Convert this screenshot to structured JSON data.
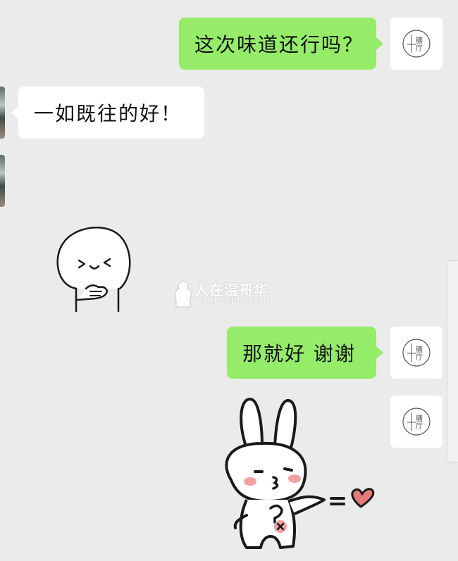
{
  "messages": {
    "m1": "这次味道还行吗？",
    "m2": "一如既往的好！",
    "m3": "那就好 谢谢"
  },
  "avatar": {
    "me_seal_text": "膳厅"
  },
  "stickers": {
    "reply_sticker": "happy-blob-sticker",
    "rabbit_sticker": "rabbit-love-sticker"
  },
  "watermark": {
    "title": "人在温哥华",
    "url": "VanPeople.com"
  },
  "colors": {
    "background": "#ebebeb",
    "sent_bubble": "#95ec69",
    "received_bubble": "#ffffff"
  }
}
